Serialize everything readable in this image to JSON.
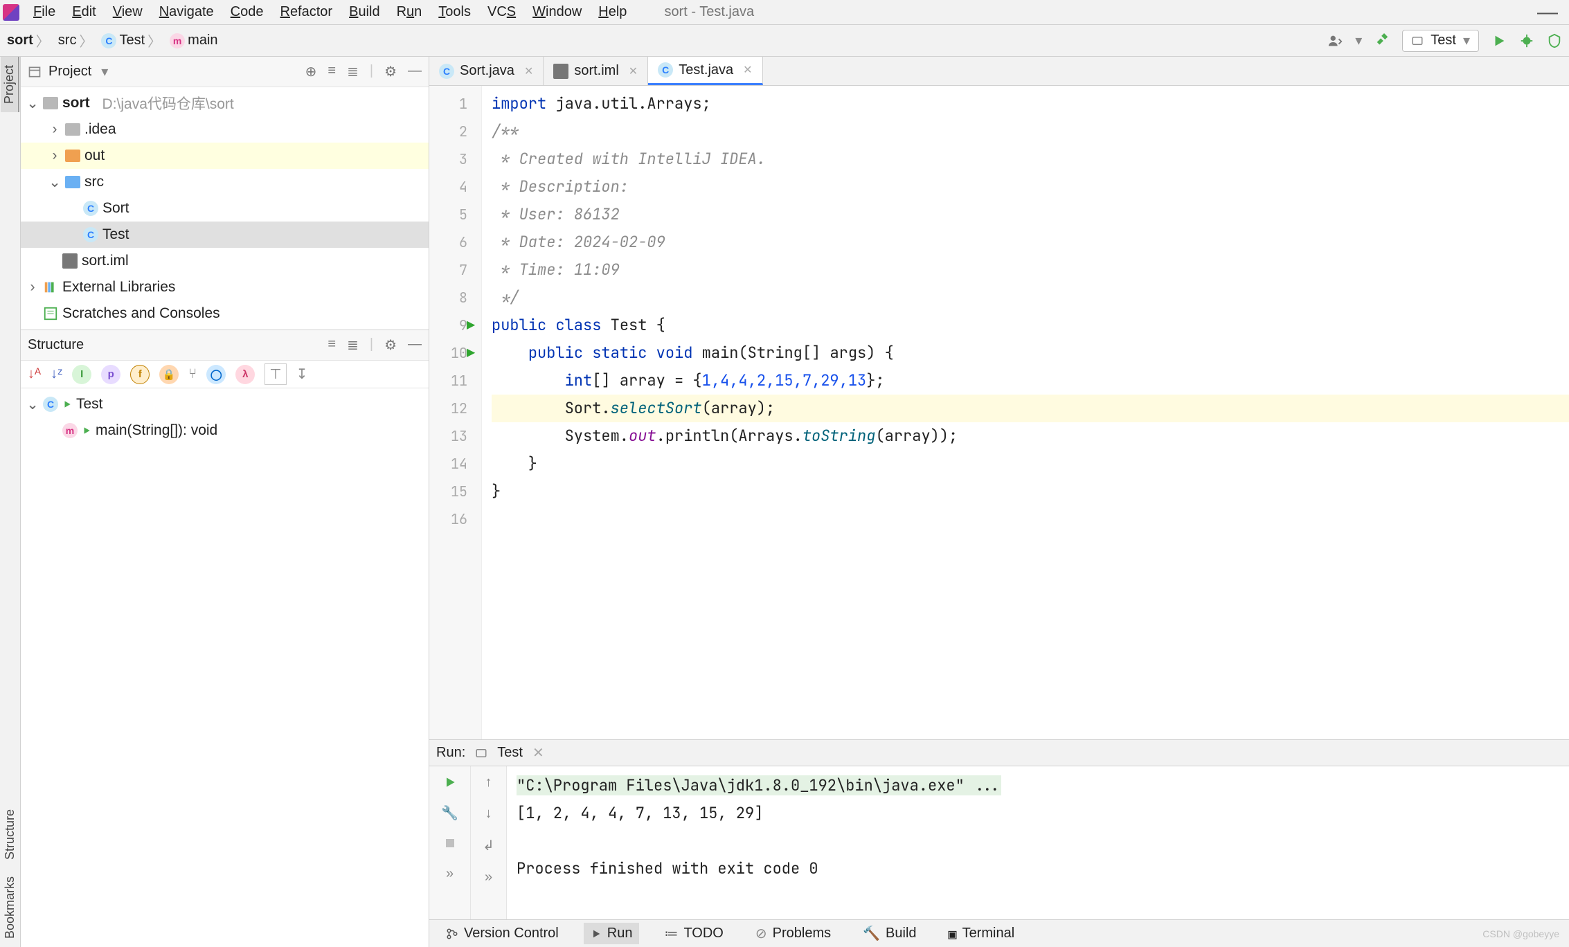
{
  "window": {
    "title": "sort - Test.java"
  },
  "menu": [
    "File",
    "Edit",
    "View",
    "Navigate",
    "Code",
    "Refactor",
    "Build",
    "Run",
    "Tools",
    "VCS",
    "Window",
    "Help"
  ],
  "breadcrumbs": [
    {
      "label": "sort",
      "icon": "none"
    },
    {
      "label": "src",
      "icon": "none"
    },
    {
      "label": "Test",
      "icon": "c"
    },
    {
      "label": "main",
      "icon": "m"
    }
  ],
  "toolbar": {
    "run_config": "Test"
  },
  "project_panel": {
    "title": "Project",
    "root": {
      "name": "sort",
      "path": "D:\\java代码仓库\\sort"
    },
    "idea": ".idea",
    "out": "out",
    "src": "src",
    "sort_class": "Sort",
    "test_class": "Test",
    "iml": "sort.iml",
    "ext_lib": "External Libraries",
    "scratches": "Scratches and Consoles"
  },
  "structure_panel": {
    "title": "Structure",
    "root": "Test",
    "main": "main(String[]): void"
  },
  "editor": {
    "tabs": [
      {
        "label": "Sort.java",
        "icon": "c",
        "active": false
      },
      {
        "label": "sort.iml",
        "icon": "iml",
        "active": false
      },
      {
        "label": "Test.java",
        "icon": "c",
        "active": true
      }
    ],
    "line_numbers": [
      "1",
      "2",
      "3",
      "4",
      "5",
      "6",
      "7",
      "8",
      "9",
      "10",
      "11",
      "12",
      "13",
      "14",
      "15",
      "16"
    ],
    "run_gutter_lines": [
      9,
      10
    ],
    "code": {
      "l1_kw": "import",
      "l1_rest": " java.util.Arrays;",
      "l2": "/**",
      "l3": " * Created with IntelliJ IDEA.",
      "l4": " * Description:",
      "l5": " * User: 86132",
      "l6": " * Date: 2024-02-09",
      "l7": " * Time: 11:09",
      "l8": " */",
      "l9_a": "public",
      "l9_b": "class",
      "l9_c": " Test {",
      "l10_a": "public",
      "l10_b": "static",
      "l10_c": "void",
      "l10_d": "main",
      "l10_e": "(String[] args) {",
      "l11_a": "int",
      "l11_b": "[] array = {",
      "l11_nums": "1,4,4,2,15,7,29,13",
      "l11_c": "};",
      "l12_a": "        Sort.",
      "l12_b": "selectSort",
      "l12_c": "(array);",
      "l13_a": "        System.",
      "l13_b": "out",
      "l13_c": ".println(Arrays.",
      "l13_d": "toString",
      "l13_e": "(array));",
      "l14": "    }",
      "l15": "}",
      "l16": ""
    }
  },
  "run": {
    "label": "Run:",
    "tab": "Test",
    "cmd": "\"C:\\Program Files\\Java\\jdk1.8.0_192\\bin\\java.exe\" ...",
    "out1": "[1, 2, 4, 4, 7, 13, 15, 29]",
    "out2": "",
    "out3": "Process finished with exit code 0"
  },
  "bottom": {
    "vc": "Version Control",
    "run": "Run",
    "todo": "TODO",
    "problems": "Problems",
    "build": "Build",
    "terminal": "Terminal",
    "watermark": "CSDN @gobeyye"
  },
  "side_tabs": {
    "project": "Project",
    "structure": "Structure",
    "bookmarks": "Bookmarks"
  }
}
